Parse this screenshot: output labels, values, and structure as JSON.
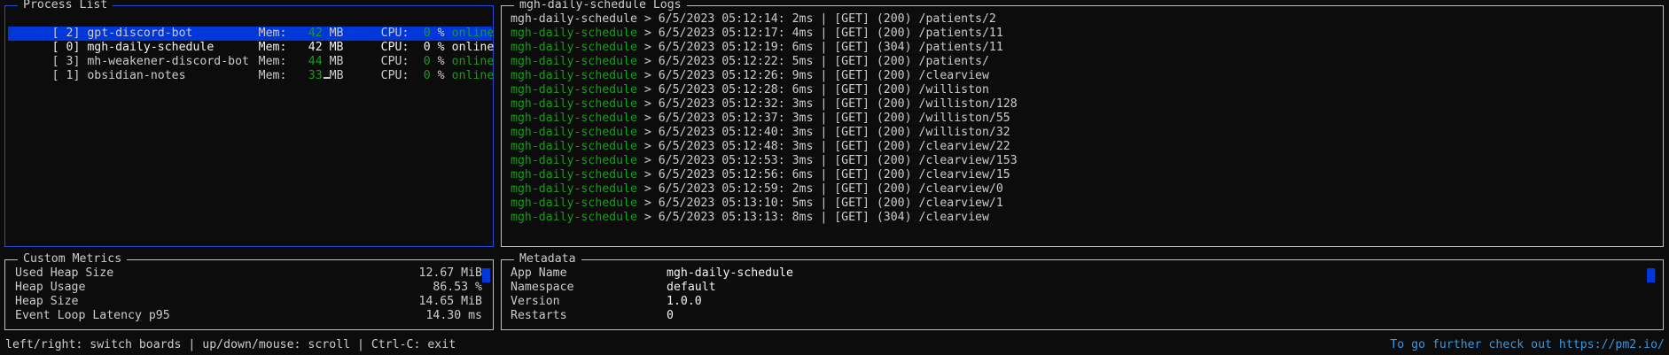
{
  "process_list": {
    "title": "Process List",
    "mem_label": "Mem:",
    "cpu_label": "CPU:",
    "mem_unit": "MB",
    "cpu_unit": "%",
    "processes": [
      {
        "id": "[ 2]",
        "name": "gpt-discord-bot",
        "mem": "42",
        "cpu": "0",
        "status": "online"
      },
      {
        "id": "[ 0]",
        "name": "mgh-daily-schedule",
        "mem": "42",
        "cpu": "0",
        "status": "online"
      },
      {
        "id": "[ 3]",
        "name": "mh-weakener-discord-bot",
        "mem": "44",
        "cpu": "0",
        "status": "online"
      },
      {
        "id": "[ 1]",
        "name": "obsidian-notes",
        "mem": "33",
        "cpu": "0",
        "status": "online"
      }
    ]
  },
  "logs": {
    "title": "mgh-daily-schedule Logs",
    "lines": [
      {
        "app": "mgh-daily-schedule",
        "text": " > 6/5/2023 05:12:14: 2ms | [GET] (200) /patients/2"
      },
      {
        "app": "mgh-daily-schedule",
        "text": " > 6/5/2023 05:12:17: 4ms | [GET] (200) /patients/11"
      },
      {
        "app": "mgh-daily-schedule",
        "text": " > 6/5/2023 05:12:19: 6ms | [GET] (304) /patients/11"
      },
      {
        "app": "mgh-daily-schedule",
        "text": " > 6/5/2023 05:12:22: 5ms | [GET] (200) /patients/"
      },
      {
        "app": "mgh-daily-schedule",
        "text": " > 6/5/2023 05:12:26: 9ms | [GET] (200) /clearview"
      },
      {
        "app": "mgh-daily-schedule",
        "text": " > 6/5/2023 05:12:28: 6ms | [GET] (200) /williston"
      },
      {
        "app": "mgh-daily-schedule",
        "text": " > 6/5/2023 05:12:32: 3ms | [GET] (200) /williston/128"
      },
      {
        "app": "mgh-daily-schedule",
        "text": " > 6/5/2023 05:12:37: 3ms | [GET] (200) /williston/55"
      },
      {
        "app": "mgh-daily-schedule",
        "text": " > 6/5/2023 05:12:40: 3ms | [GET] (200) /williston/32"
      },
      {
        "app": "mgh-daily-schedule",
        "text": " > 6/5/2023 05:12:48: 3ms | [GET] (200) /clearview/22"
      },
      {
        "app": "mgh-daily-schedule",
        "text": " > 6/5/2023 05:12:53: 3ms | [GET] (200) /clearview/153"
      },
      {
        "app": "mgh-daily-schedule",
        "text": " > 6/5/2023 05:12:56: 6ms | [GET] (200) /clearview/15"
      },
      {
        "app": "mgh-daily-schedule",
        "text": " > 6/5/2023 05:12:59: 2ms | [GET] (200) /clearview/0"
      },
      {
        "app": "mgh-daily-schedule",
        "text": " > 6/5/2023 05:13:10: 5ms | [GET] (200) /clearview/1"
      },
      {
        "app": "mgh-daily-schedule",
        "text": " > 6/5/2023 05:13:13: 8ms | [GET] (304) /clearview"
      }
    ]
  },
  "custom_metrics": {
    "title": "Custom Metrics",
    "rows": [
      {
        "label": "Used Heap Size",
        "value": "12.67 MiB"
      },
      {
        "label": "Heap Usage",
        "value": "86.53 %"
      },
      {
        "label": "Heap Size",
        "value": "14.65 MiB"
      },
      {
        "label": "Event Loop Latency p95",
        "value": "14.30 ms"
      }
    ]
  },
  "metadata": {
    "title": "Metadata",
    "rows": [
      {
        "label": "App Name",
        "value": "mgh-daily-schedule"
      },
      {
        "label": "Namespace",
        "value": "default"
      },
      {
        "label": "Version",
        "value": "1.0.0"
      },
      {
        "label": "Restarts",
        "value": "0"
      }
    ]
  },
  "footer": {
    "help": "left/right: switch boards | up/down/mouse: scroll | Ctrl-C: exit",
    "link": "To go further check out https://pm2.io/"
  },
  "colors": {
    "background": "#0c0c0c",
    "text": "#cccccc",
    "green": "#13a10e",
    "selection": "#0037da",
    "link": "#3a96dd"
  }
}
